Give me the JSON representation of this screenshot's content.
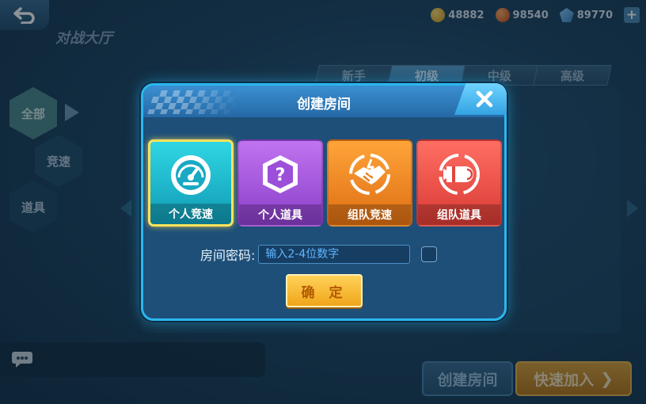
{
  "lobby": {
    "title": "对战大厅",
    "currencies": [
      {
        "name": "gold-coin-icon",
        "value": "48882",
        "color": "#e8b423"
      },
      {
        "name": "orange-token-icon",
        "value": "98540",
        "color": "#e0651c"
      },
      {
        "name": "blue-diamond-icon",
        "value": "89770",
        "color": "#5aa6e0"
      }
    ],
    "add_currency_label": "+",
    "level_tabs": [
      {
        "label": "新手",
        "active": false
      },
      {
        "label": "初级",
        "active": true
      },
      {
        "label": "中级",
        "active": false
      },
      {
        "label": "高级",
        "active": false
      }
    ],
    "categories": [
      "全部",
      "竞速",
      "道具"
    ],
    "create_room_button": "创建房间",
    "quick_join_button": "快速加入",
    "quick_join_chevron": "❯"
  },
  "modal": {
    "title": "创建房间",
    "modes": [
      {
        "label": "个人竞速",
        "icon": "speedometer-icon",
        "selected": true
      },
      {
        "label": "个人道具",
        "icon": "question-box-icon",
        "selected": false
      },
      {
        "label": "组队竞速",
        "icon": "handshake-icon",
        "selected": false
      },
      {
        "label": "组队道具",
        "icon": "missile-icon",
        "selected": false
      }
    ],
    "password_label": "房间密码:",
    "password_placeholder": "输入2-4位数字",
    "password_value": "",
    "confirm_button": "确 定"
  },
  "colors": {
    "accent_border": "#2ab7ee",
    "confirm_yellow": "#ffd25a",
    "selected_outline": "#ffe25a"
  }
}
